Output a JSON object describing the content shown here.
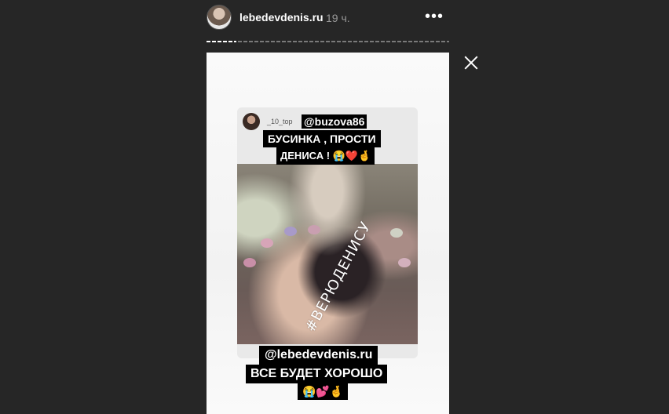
{
  "header": {
    "username": "lebedevdenis.ru",
    "time": "19 ч.",
    "more_icon": "•••"
  },
  "progress": {
    "segments": 2,
    "current": 1
  },
  "story": {
    "card": {
      "user": "_10_top",
      "mention_top": "@buzova86",
      "line1": "БУСИНКА , ПРОСТИ",
      "line2": "ДЕНИСА ! 😭❤️🤞",
      "hashtag": "#ВЕРЮДЕНИСУ"
    },
    "mention_bottom": "@lebedevdenis.ru",
    "line3": "ВСЕ БУДЕТ ХОРОШО",
    "emoji_line": "😭💕🤞"
  },
  "colors": {
    "background": "#262626",
    "story_bg": "#fafafa",
    "sticker_bg": "#000000"
  },
  "icons": {
    "close": "close-icon",
    "more": "more-options-icon"
  }
}
